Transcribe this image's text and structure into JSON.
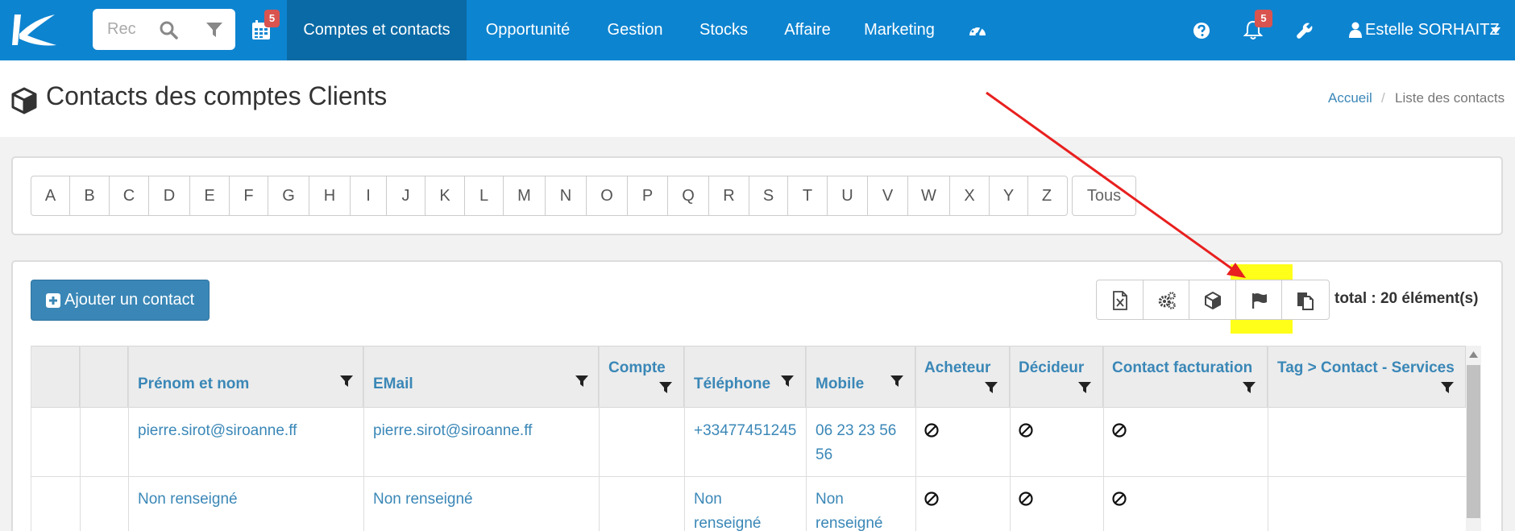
{
  "nav": {
    "search_placeholder": "Rec",
    "calendar_badge": "5",
    "items": [
      {
        "label": "Comptes et contacts",
        "active": true
      },
      {
        "label": "Opportunité"
      },
      {
        "label": "Gestion"
      },
      {
        "label": "Stocks"
      },
      {
        "label": "Affaire"
      },
      {
        "label": "Marketing"
      }
    ],
    "notifications_badge": "5",
    "user_name": "Estelle SORHAITZ",
    "colors": {
      "bar": "#0d84d0",
      "active": "#0a6aa5",
      "badge": "#d9534f"
    }
  },
  "page": {
    "title": "Contacts des comptes Clients",
    "breadcrumb": {
      "home": "Accueil",
      "separator": "/",
      "current": "Liste des contacts"
    }
  },
  "letters": [
    "A",
    "B",
    "C",
    "D",
    "E",
    "F",
    "G",
    "H",
    "I",
    "J",
    "K",
    "L",
    "M",
    "N",
    "O",
    "P",
    "Q",
    "R",
    "S",
    "T",
    "U",
    "V",
    "W",
    "X",
    "Y",
    "Z"
  ],
  "letters_all": "Tous",
  "toolbar": {
    "add_label": "Ajouter un contact",
    "tools": [
      "excel-export-icon",
      "cogs-icon",
      "cube-icon",
      "flag-icon",
      "copy-icon"
    ],
    "highlighted_tool": "flag-icon",
    "total": "total : 20 élément(s)"
  },
  "table": {
    "columns": [
      "Prénom et nom",
      "EMail",
      "Compte",
      "Téléphone",
      "Mobile",
      "Acheteur",
      "Décideur",
      "Contact facturation",
      "Tag > Contact - Services"
    ],
    "rows": [
      {
        "name": "pierre.sirot@siroanne.ff",
        "email": "pierre.sirot@siroanne.ff",
        "compte": "",
        "telephone": "+33477451245",
        "mobile_1": "06 23 23 56",
        "mobile_2": "56",
        "acheteur": "ban-icon",
        "decideur": "ban-icon",
        "facturation": "ban-icon",
        "tag": ""
      },
      {
        "name": "Non renseigné",
        "email": "Non renseigné",
        "compte": "",
        "telephone_1": "Non",
        "telephone_2": "renseigné",
        "mobile_1": "Non",
        "mobile_2": "renseigné",
        "acheteur": "ban-icon",
        "decideur": "ban-icon",
        "facturation": "ban-icon",
        "tag": ""
      }
    ]
  },
  "annotation": {
    "arrow_color": "#e8201f",
    "highlight_color": "#ffff1a"
  }
}
